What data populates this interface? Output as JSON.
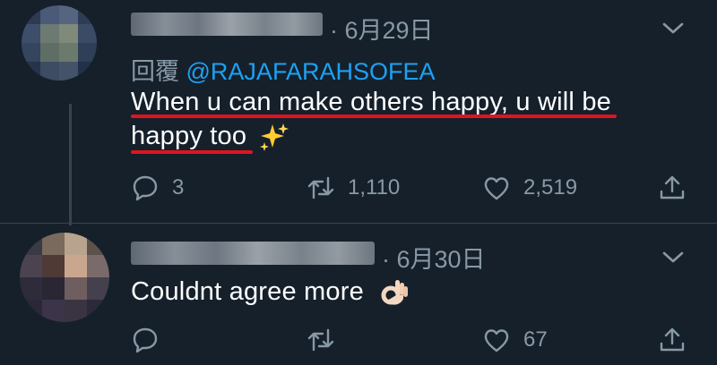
{
  "tweets": [
    {
      "date": "· 6月29日",
      "reply_label": "回覆",
      "reply_handle": "@RAJAFARAHSOFEA",
      "text_line1": "When u can make others happy, u will be",
      "text_line2": "happy too",
      "emoji": "sparkles-emoji",
      "replies": "3",
      "retweets": "1,110",
      "likes": "2,519",
      "highlight_color": "#e0141e"
    },
    {
      "date": "· 6月30日",
      "text": "Couldnt agree more",
      "emoji": "ok-hand-emoji",
      "replies": "",
      "retweets": "",
      "likes": "67"
    }
  ],
  "icons": {
    "reply": "reply-icon",
    "retweet": "retweet-icon",
    "like": "heart-icon",
    "share": "share-icon",
    "menu": "chevron-down-icon"
  },
  "colors": {
    "background": "#15202b",
    "muted": "#8899a6",
    "link": "#1da1f2"
  }
}
